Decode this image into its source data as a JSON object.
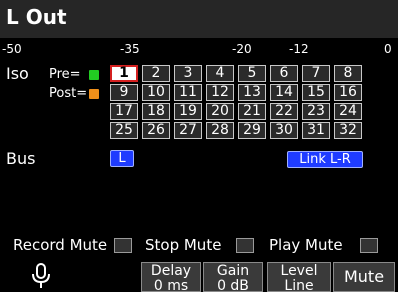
{
  "title": "L Out",
  "meter_scale": [
    "-50",
    "-35",
    "-20",
    "-12",
    "0"
  ],
  "iso": {
    "label": "Iso",
    "pre_label": "Pre=",
    "post_label": "Post=",
    "pre_color": "#22cc22",
    "post_color": "#f0901a",
    "selected_channel": "1",
    "channels": [
      "1",
      "2",
      "3",
      "4",
      "5",
      "6",
      "7",
      "8",
      "9",
      "10",
      "11",
      "12",
      "13",
      "14",
      "15",
      "16",
      "17",
      "18",
      "19",
      "20",
      "21",
      "22",
      "23",
      "24",
      "25",
      "26",
      "27",
      "28",
      "29",
      "30",
      "31",
      "32"
    ]
  },
  "bus": {
    "label": "Bus",
    "l_button": "L",
    "link_button": "Link L-R",
    "button_color": "#1f3cff"
  },
  "mutes": {
    "record_mute": "Record Mute",
    "stop_mute": "Stop Mute",
    "play_mute": "Play Mute"
  },
  "softkeys": {
    "mic_icon": "microphone-icon",
    "delay_line1": "Delay",
    "delay_line2": "0 ms",
    "gain_line1": "Gain",
    "gain_line2": "0 dB",
    "level_line1": "Level",
    "level_line2": "Line",
    "mute": "Mute"
  }
}
